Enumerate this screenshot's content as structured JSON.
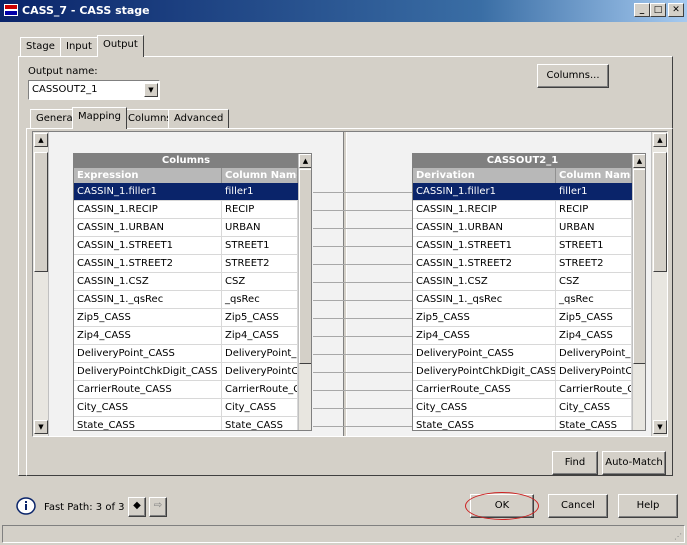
{
  "window": {
    "title": "CASS_7 - CASS stage",
    "controls": [
      "minimize",
      "maximize",
      "close"
    ]
  },
  "stage_tabs": [
    "Stage",
    "Input",
    "Output"
  ],
  "active_stage_tab": "Output",
  "output_name": {
    "label": "Output name:",
    "value": "CASSOUT2_1"
  },
  "columns_button": "Columns...",
  "sub_tabs": [
    "General",
    "Mapping",
    "Columns",
    "Advanced"
  ],
  "active_sub_tab": "Mapping",
  "left_grid": {
    "title": "Columns",
    "headers": [
      "Expression",
      "Column Name"
    ],
    "rows": [
      [
        "CASSIN_1.filler1",
        "filler1"
      ],
      [
        "CASSIN_1.RECIP",
        "RECIP"
      ],
      [
        "CASSIN_1.URBAN",
        "URBAN"
      ],
      [
        "CASSIN_1.STREET1",
        "STREET1"
      ],
      [
        "CASSIN_1.STREET2",
        "STREET2"
      ],
      [
        "CASSIN_1.CSZ",
        "CSZ"
      ],
      [
        "CASSIN_1._qsRec",
        "_qsRec"
      ],
      [
        "Zip5_CASS",
        "Zip5_CASS"
      ],
      [
        "Zip4_CASS",
        "Zip4_CASS"
      ],
      [
        "DeliveryPoint_CASS",
        "DeliveryPoint_CASS"
      ],
      [
        "DeliveryPointChkDigit_CASS",
        "DeliveryPointChkDigit_CASS"
      ],
      [
        "CarrierRoute_CASS",
        "CarrierRoute_CASS"
      ],
      [
        "City_CASS",
        "City_CASS"
      ],
      [
        "State_CASS",
        "State_CASS"
      ]
    ],
    "selected_row": 0
  },
  "right_grid": {
    "title": "CASSOUT2_1",
    "headers": [
      "Derivation",
      "Column Name"
    ],
    "rows": [
      [
        "CASSIN_1.filler1",
        "filler1"
      ],
      [
        "CASSIN_1.RECIP",
        "RECIP"
      ],
      [
        "CASSIN_1.URBAN",
        "URBAN"
      ],
      [
        "CASSIN_1.STREET1",
        "STREET1"
      ],
      [
        "CASSIN_1.STREET2",
        "STREET2"
      ],
      [
        "CASSIN_1.CSZ",
        "CSZ"
      ],
      [
        "CASSIN_1._qsRec",
        "_qsRec"
      ],
      [
        "Zip5_CASS",
        "Zip5_CASS"
      ],
      [
        "Zip4_CASS",
        "Zip4_CASS"
      ],
      [
        "DeliveryPoint_CASS",
        "DeliveryPoint_CASS"
      ],
      [
        "DeliveryPointChkDigit_CASS",
        "DeliveryPointChkDigit_CASS"
      ],
      [
        "CarrierRoute_CASS",
        "CarrierRoute_CASS"
      ],
      [
        "City_CASS",
        "City_CASS"
      ],
      [
        "State_CASS",
        "State_CASS"
      ]
    ],
    "selected_row": 0
  },
  "find_button": "Find",
  "automatch_button": "Auto-Match",
  "fast_path": {
    "label": "Fast Path: 3 of 3",
    "prev_icon": "arrow-left-icon",
    "next_icon": "arrow-right-icon"
  },
  "ok_button": "OK",
  "cancel_button": "Cancel",
  "help_button": "Help",
  "colors": {
    "title_bar": "#0a246a",
    "selection": "#0a246a",
    "ok_highlight": "#cc2222",
    "grid_title": "#808080"
  }
}
